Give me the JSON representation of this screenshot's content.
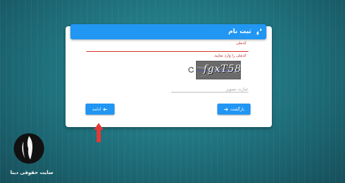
{
  "form": {
    "title": "ثبت نام",
    "code_label": "کدملی",
    "code_error": "کدملی را وارد نمایید.",
    "captcha_text": "fgxT58",
    "captcha_placeholder": "عبارت تصویر",
    "next_label": "ادامه",
    "back_label": "بازگشت"
  },
  "branding": {
    "site_name": "سایت حقوقی دینا"
  },
  "colors": {
    "primary": "#2196f3",
    "error": "#d32f2f",
    "arrow": "#e53935",
    "background": "#1e6f7b"
  },
  "icons": {
    "header": "user-plus-icon",
    "refresh": "refresh-icon",
    "next": "arrow-left-icon",
    "back": "arrow-right-icon",
    "pointer": "red-arrow-up-icon"
  }
}
